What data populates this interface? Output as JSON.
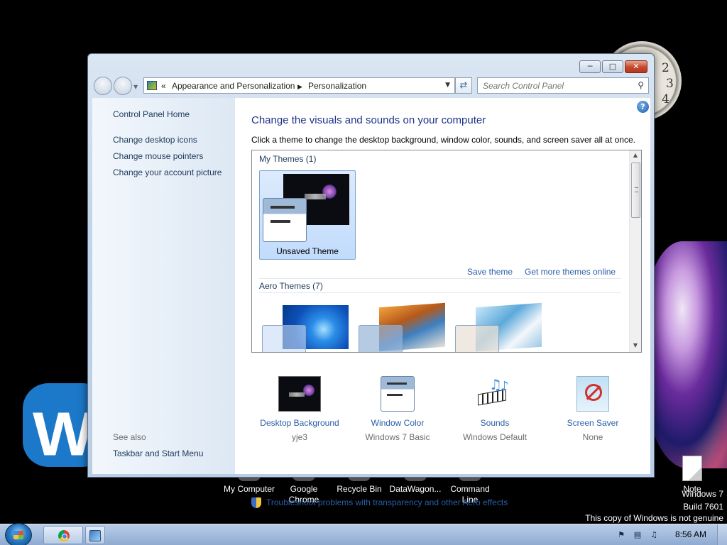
{
  "window": {
    "breadcrumb_root": "Appearance and Personalization",
    "breadcrumb_current": "Personalization",
    "search_placeholder": "Search Control Panel"
  },
  "sidebar": {
    "home": "Control Panel Home",
    "links": [
      "Change desktop icons",
      "Change mouse pointers",
      "Change your account picture"
    ],
    "see_also_title": "See also",
    "see_also_link": "Taskbar and Start Menu"
  },
  "content": {
    "title": "Change the visuals and sounds on your computer",
    "subtitle": "Click a theme to change the desktop background, window color, sounds, and screen saver all at once.",
    "my_themes_header": "My Themes (1)",
    "selected_theme": "Unsaved Theme",
    "save_theme": "Save theme",
    "get_more": "Get more themes online",
    "aero_themes_header": "Aero Themes (7)",
    "troubleshoot": "Troubleshoot problems with transparency and other Aero effects"
  },
  "settings": [
    {
      "label": "Desktop Background",
      "value": "yje3",
      "icon": "desktop-background-icon"
    },
    {
      "label": "Window Color",
      "value": "Windows 7 Basic",
      "icon": "window-color-icon"
    },
    {
      "label": "Sounds",
      "value": "Windows Default",
      "icon": "sounds-icon"
    },
    {
      "label": "Screen Saver",
      "value": "None",
      "icon": "screen-saver-icon"
    }
  ],
  "desktop_icons": [
    {
      "label": "My Computer"
    },
    {
      "label": "Google Chrome"
    },
    {
      "label": "Recycle Bin"
    },
    {
      "label": "DataWagon..."
    },
    {
      "label": "Command Line"
    },
    {
      "label": "Note"
    }
  ],
  "watermark": [
    "Windows 7",
    "Build 7601",
    "This copy of Windows is not genuine"
  ],
  "clock_numbers": [
    "2",
    "3",
    "4"
  ],
  "taskbar": {
    "time": "8:56 AM"
  },
  "colors": {
    "link": "#2a5ea8",
    "title": "#1e3287",
    "taskbar": "#a6bfe0"
  }
}
